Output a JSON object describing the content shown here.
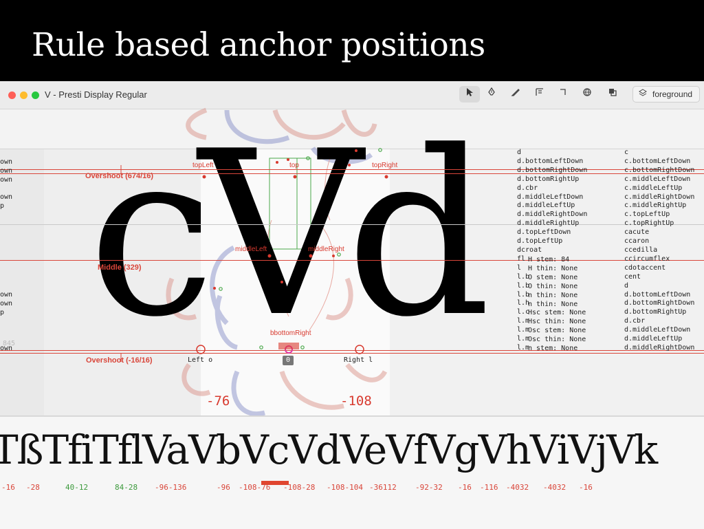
{
  "slide": {
    "title": "Rule based anchor positions"
  },
  "window": {
    "title": "V - Presti Display Regular",
    "controls": {
      "close_color": "#fe5f57",
      "minimize_color": "#febc2e",
      "zoom_color": "#28c840"
    },
    "tools": [
      "select-tool",
      "pen-tool",
      "knife-tool",
      "metrics-tool",
      "corner-tool",
      "brush-tool",
      "layers-tool"
    ],
    "layer_name": "foreground"
  },
  "editor": {
    "glyph_string": "cVd",
    "metrics": {
      "overshoot_top": "Overshoot (674/16)",
      "middle": "Middle (329)",
      "overshoot_bottom": "Overshoot (-16/16)"
    },
    "anchors": {
      "top_left": "topLeft",
      "top": "top",
      "top_right": "topRight",
      "middle_left": "middleLeft",
      "middle_right": "middleRight",
      "bottom_cluster": "bbottomRight"
    },
    "sidebearings": {
      "left_label": "Left o",
      "right_label": "Right l",
      "center_value": "0",
      "left_value": "-76",
      "right_value": "-108"
    },
    "left_column": [
      "own",
      "own",
      "own",
      "own",
      "p",
      "own",
      "own",
      "p",
      "own"
    ],
    "faint_number": "845"
  },
  "glyph_list": {
    "col1": [
      "d",
      "d.bottomLeftDown",
      "d.bottomRightDown",
      "d.bottomRightUp",
      "d.cbr",
      "d.middleLeftDown",
      "d.middleLeftUp",
      "d.middleRightDown",
      "d.middleRightUp",
      "d.topLeftDown",
      "d.topLeftUp",
      "dcroat",
      "fl",
      "l",
      "l.b",
      "l.b",
      "l.b",
      "l.h",
      "l.c",
      "l.m",
      "l.m",
      "l.m",
      "l.m"
    ],
    "col2": [
      "c",
      "c.bottomLeftDown",
      "c.bottomRightDown",
      "c.middleLeftDown",
      "c.middleLeftUp",
      "c.middleRightDown",
      "c.middleRightUp",
      "c.topLeftUp",
      "c.topRightUp",
      "cacute",
      "ccaron",
      "ccedilla",
      "ccircumflex",
      "cdotaccent",
      "cent",
      "d",
      "d.bottomLeftDown",
      "d.bottomRightDown",
      "d.bottomRightUp",
      "d.cbr",
      "d.middleLeftDown",
      "d.middleLeftUp",
      "d.middleRightDown"
    ]
  },
  "info": {
    "lines": [
      "H stem: 84",
      "H thin: None",
      "O stem: None",
      "O thin: None",
      "n thin: None",
      "n thin: None",
      "Hsc stem: None",
      "Hsc thin: None",
      "Osc stem: None",
      "Osc thin: None",
      "n stem: None"
    ]
  },
  "preview": {
    "text": "TßTfiTflVaVbVcVdVeVfVgVhViVjVk",
    "kerning": [
      {
        "v": "-16",
        "c": "#d9463a"
      },
      {
        "v": "-28",
        "c": "#d9463a"
      },
      {
        "v": "40-12",
        "c": "#3c9a3c"
      },
      {
        "v": "84-28",
        "c": "#3c9a3c"
      },
      {
        "v": "-96-136",
        "c": "#d9463a"
      },
      {
        "v": "-96",
        "c": "#d9463a"
      },
      {
        "v": "-108-76",
        "c": "#d9463a"
      },
      {
        "v": "-108-28",
        "c": "#d9463a"
      },
      {
        "v": "-108-104",
        "c": "#d9463a"
      },
      {
        "v": "-36112",
        "c": "#d9463a"
      },
      {
        "v": "-92-32",
        "c": "#d9463a"
      },
      {
        "v": "-16",
        "c": "#d9463a"
      },
      {
        "v": "-116",
        "c": "#d9463a"
      },
      {
        "v": "-4032",
        "c": "#d9463a"
      },
      {
        "v": "-4032",
        "c": "#d9463a"
      },
      {
        "v": "-16",
        "c": "#d9463a"
      }
    ]
  }
}
